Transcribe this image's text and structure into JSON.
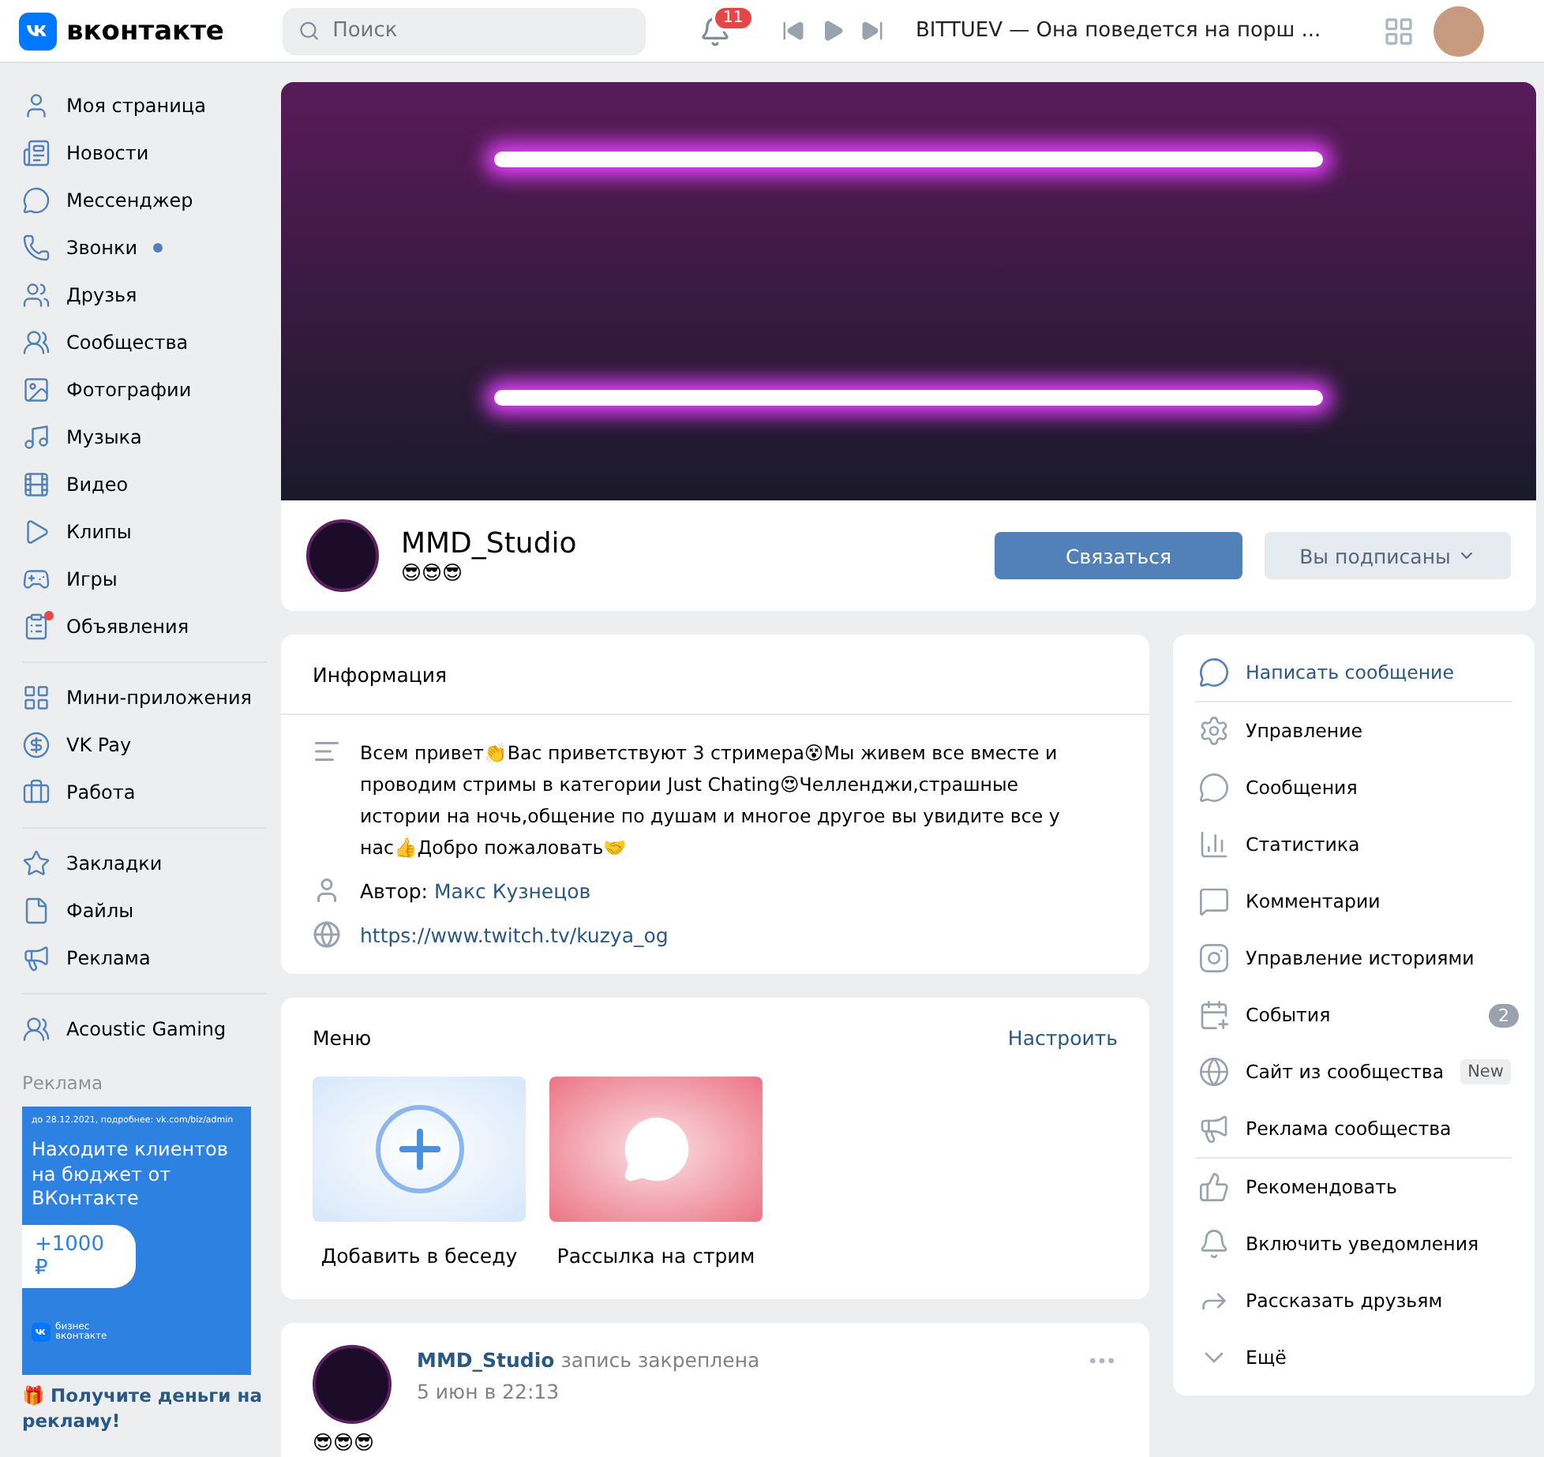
{
  "header": {
    "logo": "вконтакте",
    "search": {
      "placeholder": "Поиск"
    },
    "notifications": "11",
    "track": "BITTUEV — Она поведется на порш ..."
  },
  "sidebar": {
    "groups": [
      [
        {
          "label": "Моя страница"
        },
        {
          "label": "Новости"
        },
        {
          "label": "Мессенджер"
        },
        {
          "label": "Звонки",
          "color": "#5181b8"
        },
        {
          "label": "Друзья"
        },
        {
          "label": "Сообщества"
        },
        {
          "label": "Фотографии"
        },
        {
          "label": "Музыка"
        },
        {
          "label": "Видео"
        },
        {
          "label": "Клипы"
        },
        {
          "label": "Игры"
        },
        {
          "label": "Объявления",
          "color": "#e64646"
        }
      ],
      [
        {
          "label": "Мини-приложения"
        },
        {
          "label": "VK Pay"
        },
        {
          "label": "Работа"
        }
      ],
      [
        {
          "label": "Закладки"
        },
        {
          "label": "Файлы"
        },
        {
          "label": "Реклама"
        }
      ],
      [
        {
          "label": "Acoustic Gaming"
        }
      ]
    ],
    "ad": {
      "heading": "Реклама",
      "note": "до 28.12.2021, подробнее: vk.com/biz/admin",
      "title": "Находите клиентов на бюджет от ВКонтакте",
      "bonus": "+1000 ₽",
      "brand_top": "бизнес",
      "brand_bottom": "вконтакте",
      "link": "🎁 Получите деньги на рекламу!"
    }
  },
  "group": {
    "name": "MMD_Studio",
    "status": "😎😎😎",
    "contact_button": "Связаться",
    "subscribed_button": "Вы подписаны"
  },
  "info": {
    "title": "Информация",
    "description": "Всем привет👏Вас приветствуют 3 стримера😵Мы живем все вместе и проводим стримы в категории Just Chating😍Челленджи,страшные истории на ночь,общение по душам и многое другое вы увидите все у нас👍Добро пожаловать🤝",
    "author_label": "Автор:",
    "author": "Макс Кузнецов",
    "link": "https://www.twitch.tv/kuzya_og"
  },
  "menu": {
    "title": "Меню",
    "configure": "Настроить",
    "items": [
      {
        "label": "Добавить в беседу",
        "kind": "add"
      },
      {
        "label": "Рассылка на стрим",
        "kind": "mailing"
      }
    ]
  },
  "post": {
    "author": "MMD_Studio",
    "action": "запись закреплена",
    "date": "5 июн в 22:13",
    "text": "😎😎😎"
  },
  "actions": [
    {
      "label": "Написать сообщение",
      "primary": true
    },
    {
      "label": "Управление",
      "divider_before": true
    },
    {
      "label": "Сообщения"
    },
    {
      "label": "Статистика"
    },
    {
      "label": "Комментарии"
    },
    {
      "label": "Управление историями"
    },
    {
      "label": "События",
      "count": "2"
    },
    {
      "label": "Сайт из сообщества",
      "badge": "New"
    },
    {
      "label": "Реклама сообщества"
    },
    {
      "label": "Рекомендовать",
      "divider_before": true
    },
    {
      "label": "Включить уведомления"
    },
    {
      "label": "Рассказать друзьям"
    },
    {
      "label": "Ещё"
    }
  ]
}
